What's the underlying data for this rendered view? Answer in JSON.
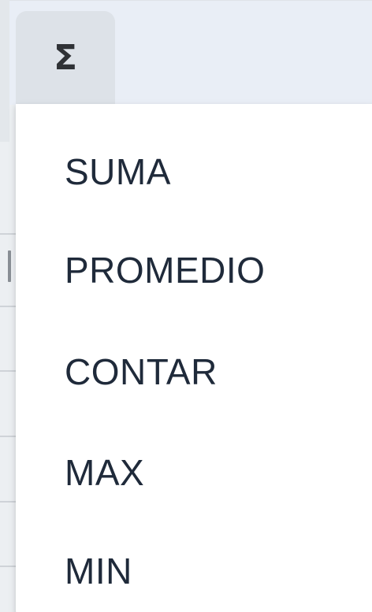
{
  "toolbar": {
    "aggregate_button_icon": "sigma-icon",
    "aggregate_button_glyph": "Σ"
  },
  "menu": {
    "items": [
      {
        "label": "SUMA"
      },
      {
        "label": "PROMEDIO"
      },
      {
        "label": "CONTAR"
      },
      {
        "label": "MAX"
      },
      {
        "label": "MIN"
      }
    ]
  },
  "colors": {
    "toolbar_background": "#e9eef6",
    "button_background": "#dde2e8",
    "menu_background": "#ffffff",
    "menu_text": "#1f2a3a"
  }
}
